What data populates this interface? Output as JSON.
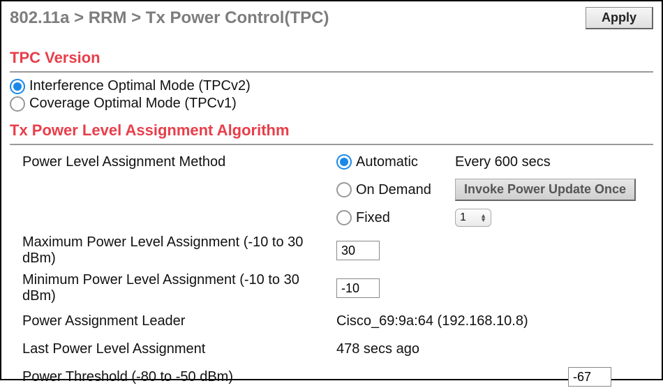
{
  "header": {
    "breadcrumb": "802.11a > RRM > Tx Power Control(TPC)",
    "apply_label": "Apply"
  },
  "tpc_version": {
    "title": "TPC Version",
    "options": [
      {
        "label": "Interference Optimal Mode (TPCv2)",
        "selected": true
      },
      {
        "label": "Coverage Optimal Mode (TPCv1)",
        "selected": false
      }
    ]
  },
  "algorithm": {
    "title": "Tx Power Level Assignment Algorithm",
    "method_label": "Power Level Assignment Method",
    "methods": {
      "automatic": {
        "label": "Automatic",
        "interval_text": "Every 600 secs",
        "selected": true
      },
      "on_demand": {
        "label": "On Demand",
        "invoke_label": "Invoke Power Update Once",
        "selected": false
      },
      "fixed": {
        "label": "Fixed",
        "value": "1",
        "selected": false
      }
    },
    "max_power": {
      "label": "Maximum Power Level Assignment (-10 to 30 dBm)",
      "value": "30"
    },
    "min_power": {
      "label": "Minimum Power Level Assignment (-10 to 30 dBm)",
      "value": "-10"
    },
    "leader": {
      "label": "Power Assignment Leader",
      "value": "Cisco_69:9a:64 (192.168.10.8)"
    },
    "last": {
      "label": "Last Power Level Assignment",
      "value": "478 secs ago"
    },
    "threshold": {
      "label": "Power Threshold (-80 to -50 dBm)",
      "value": "-67"
    }
  }
}
